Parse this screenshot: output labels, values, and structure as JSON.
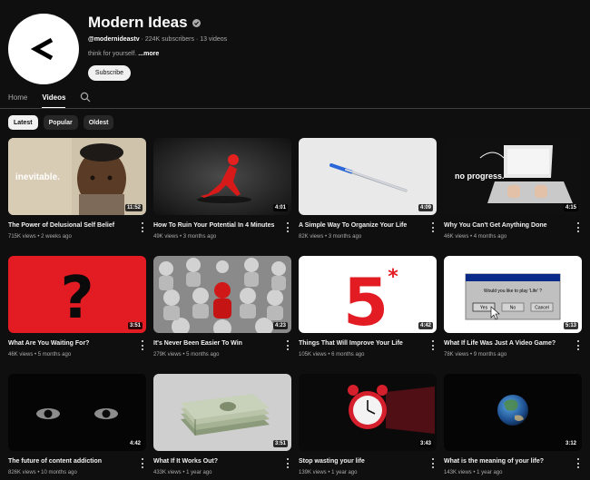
{
  "channel": {
    "name": "Modern Ideas",
    "handle": "@modernideastv",
    "subscribers": "224K subscribers",
    "video_count": "13 videos",
    "description": "think for yourself.",
    "more_label": "...more",
    "subscribe_label": "Subscribe"
  },
  "tabs": [
    {
      "label": "Home"
    },
    {
      "label": "Videos"
    }
  ],
  "chips": [
    {
      "label": "Latest"
    },
    {
      "label": "Popular"
    },
    {
      "label": "Oldest"
    }
  ],
  "videos": [
    {
      "title": "The Power of Delusional Self Belief",
      "views": "715K views",
      "age": "2 weeks ago",
      "duration": "11:52",
      "thumb_text": "inevitable."
    },
    {
      "title": "How To Ruin Your Potential In 4 Minutes",
      "views": "49K views",
      "age": "3 months ago",
      "duration": "4:01"
    },
    {
      "title": "A Simple Way To Organize Your Life",
      "views": "82K views",
      "age": "3 months ago",
      "duration": "4:09"
    },
    {
      "title": "Why You Can't Get Anything Done",
      "views": "46K views",
      "age": "4 months ago",
      "duration": "4:15",
      "thumb_text": "no progress."
    },
    {
      "title": "What Are You Waiting For?",
      "views": "46K views",
      "age": "5 months ago",
      "duration": "3:51"
    },
    {
      "title": "It's Never Been Easier To Win",
      "views": "279K views",
      "age": "5 months ago",
      "duration": "4:23"
    },
    {
      "title": "Things That Will Improve Your Life",
      "views": "105K views",
      "age": "6 months ago",
      "duration": "4:42"
    },
    {
      "title": "What If Life Was Just A Video Game?",
      "views": "78K views",
      "age": "9 months ago",
      "duration": "5:13",
      "dialog_text": "Would you like to play 'Life' ?",
      "dialog_yes": "Yes",
      "dialog_no": "No",
      "dialog_cancel": "Cancel"
    },
    {
      "title": "The future of content addiction",
      "views": "826K views",
      "age": "10 months ago",
      "duration": "4:42"
    },
    {
      "title": "What If It Works Out?",
      "views": "433K views",
      "age": "1 year ago",
      "duration": "3:51"
    },
    {
      "title": "Stop wasting your life",
      "views": "139K views",
      "age": "1 year ago",
      "duration": "3:43"
    },
    {
      "title": "What is the meaning of your life?",
      "views": "143K views",
      "age": "1 year ago",
      "duration": "3:12"
    }
  ],
  "colors": {
    "background": "#0f0f0f",
    "text_primary": "#f1f1f1",
    "text_secondary": "#aaaaaa",
    "chip_bg": "#272727",
    "accent_red": "#e31b23"
  }
}
